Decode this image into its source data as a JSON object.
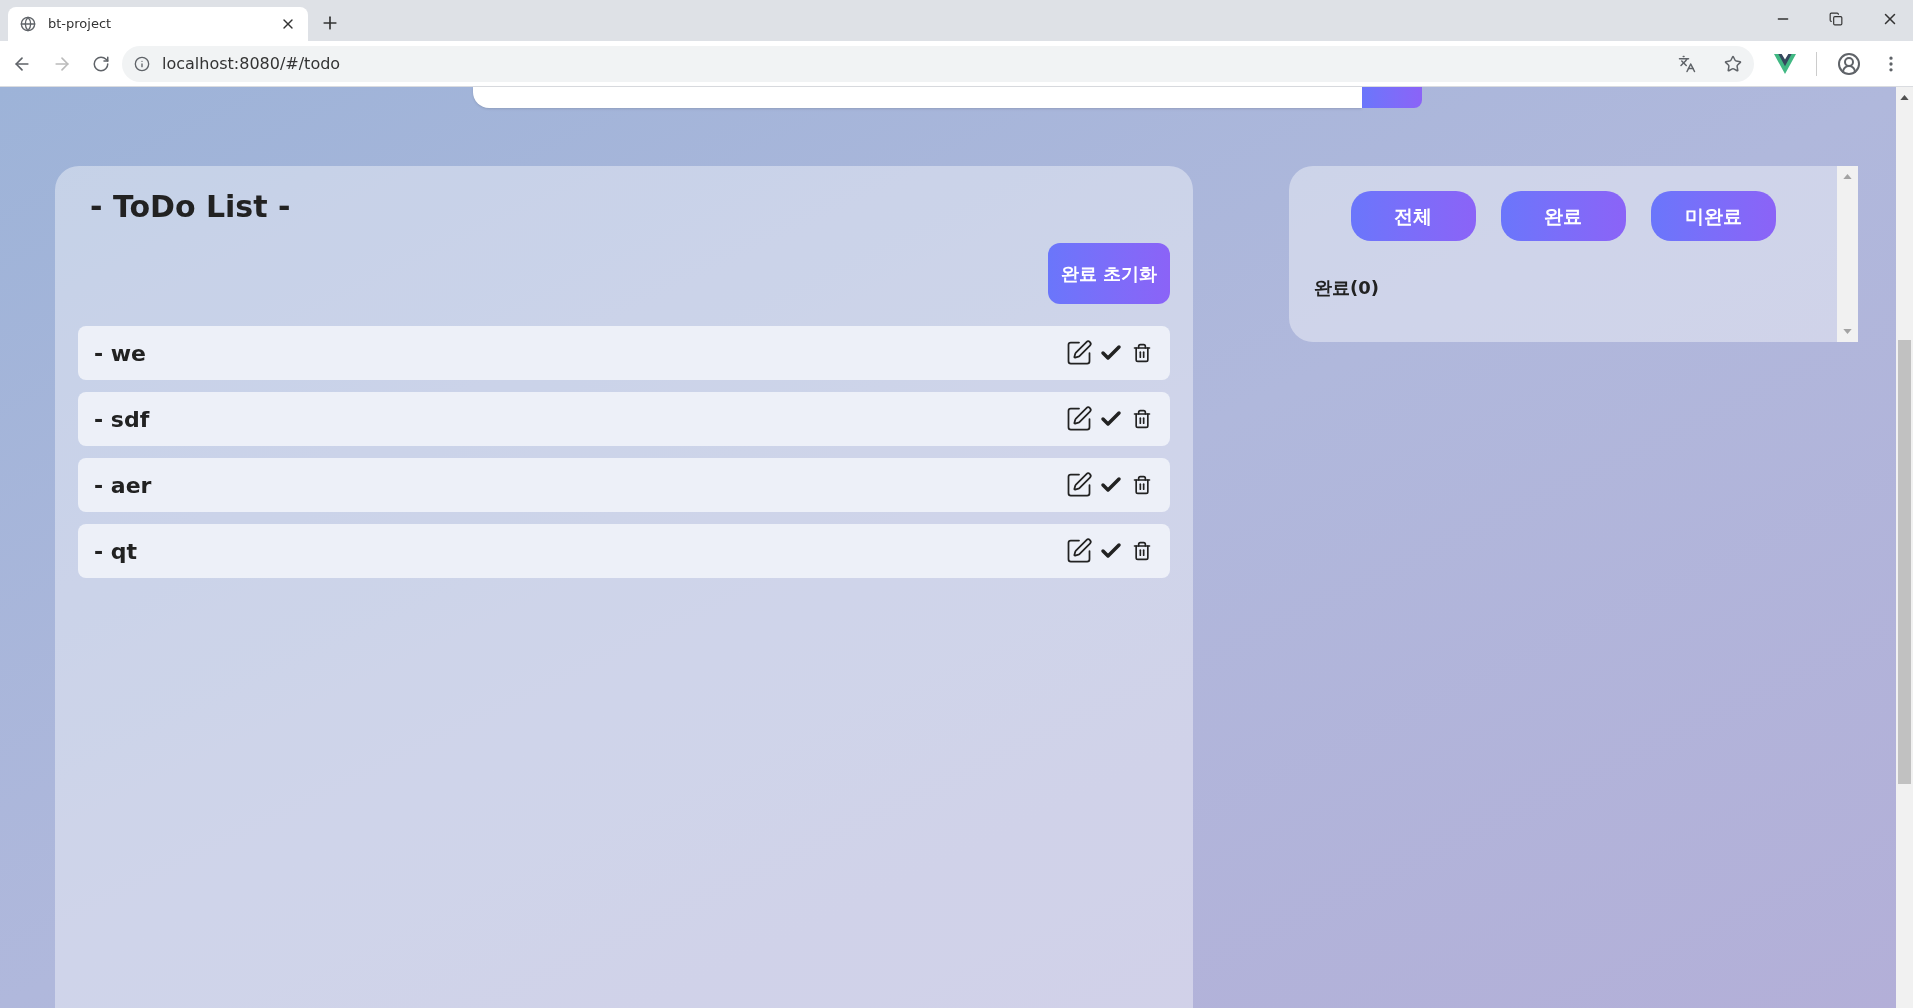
{
  "browser": {
    "tab_title": "bt-project",
    "url": "localhost:8080/#/todo"
  },
  "todo": {
    "title": "- ToDo List -",
    "reset_button": "완료 초기화",
    "items": [
      {
        "text": "- we"
      },
      {
        "text": "- sdf"
      },
      {
        "text": "- aer"
      },
      {
        "text": "- qt"
      }
    ]
  },
  "filter": {
    "buttons": [
      {
        "label": "전체"
      },
      {
        "label": "완료"
      },
      {
        "label": "미완료"
      }
    ],
    "label": "완료(0)"
  }
}
